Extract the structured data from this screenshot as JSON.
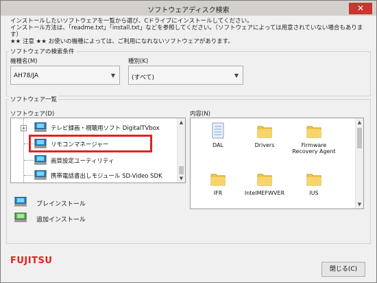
{
  "window": {
    "title": "ソフトウェアディスク検索",
    "close_glyph": "✕"
  },
  "intro": {
    "line1": "インストールしたいソフトウェアを一覧から選び、Cドライブにインストールしてください。",
    "line2": "インストール方法は、「readme.txt」「install.txt」などを参照してください。（ソフトウェアによっては用意されていない場合もあります）",
    "line3": "★★ 注意 ★★ お使いの機種によっては、ご利用になれないソフトウェアがあります。"
  },
  "search": {
    "group_label": "ソフトウェアの検索条件",
    "model_label": "機種名(M)",
    "model_value": "AH78/JA",
    "type_label": "種別(K)",
    "type_value": "(すべて)"
  },
  "list": {
    "group_label": "ソフトウェア一覧",
    "software_label": "ソフトウェア(D)",
    "content_label": "内容(N)",
    "tree_items": [
      {
        "label": "テレビ録画・視聴用ソフト DigitalTVbox"
      },
      {
        "label": "リモコンマネージャー"
      },
      {
        "label": "画質設定ユーティリティ"
      },
      {
        "label": "携帯電話書出しモジュール SD-Video SDK"
      }
    ],
    "files": [
      {
        "name": "DAL"
      },
      {
        "name": "Drivers"
      },
      {
        "name": "Firmware\nRecovery Agent"
      },
      {
        "name": "IFR"
      },
      {
        "name": "IntelMEFWVER"
      },
      {
        "name": "IUS"
      }
    ]
  },
  "legend": {
    "preinstall": "プレインストール",
    "add_install": "追加インストール"
  },
  "footer": {
    "brand": "FUJITSU",
    "close_button": "閉じる(C)"
  },
  "colors": {
    "highlight": "#e3211b",
    "folder": "#f3c54a",
    "pc_screen": "#1f8fd6",
    "pc_screen_add": "#57b84a"
  }
}
